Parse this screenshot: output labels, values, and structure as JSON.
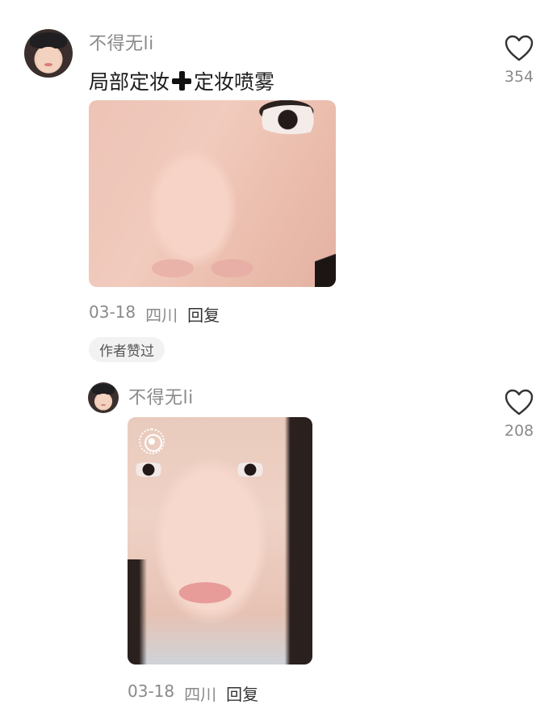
{
  "comments": [
    {
      "username": "不得无li",
      "text_part1": "局部定妆",
      "text_part2": "定妆喷雾",
      "date": "03-18",
      "location": "四川",
      "reply_label": "回复",
      "author_badge": "作者赞过",
      "likes": "354"
    },
    {
      "username": "不得无li",
      "date": "03-18",
      "location": "四川",
      "reply_label": "回复",
      "likes": "208"
    }
  ],
  "icons": {
    "like": "heart-outline-icon",
    "plus": "heavy-plus-emoji-icon",
    "live_photo": "live-photo-icon"
  },
  "colors": {
    "username": "#8a8a8a",
    "text": "#1c1c1c",
    "badge_bg": "#f2f2f2"
  }
}
